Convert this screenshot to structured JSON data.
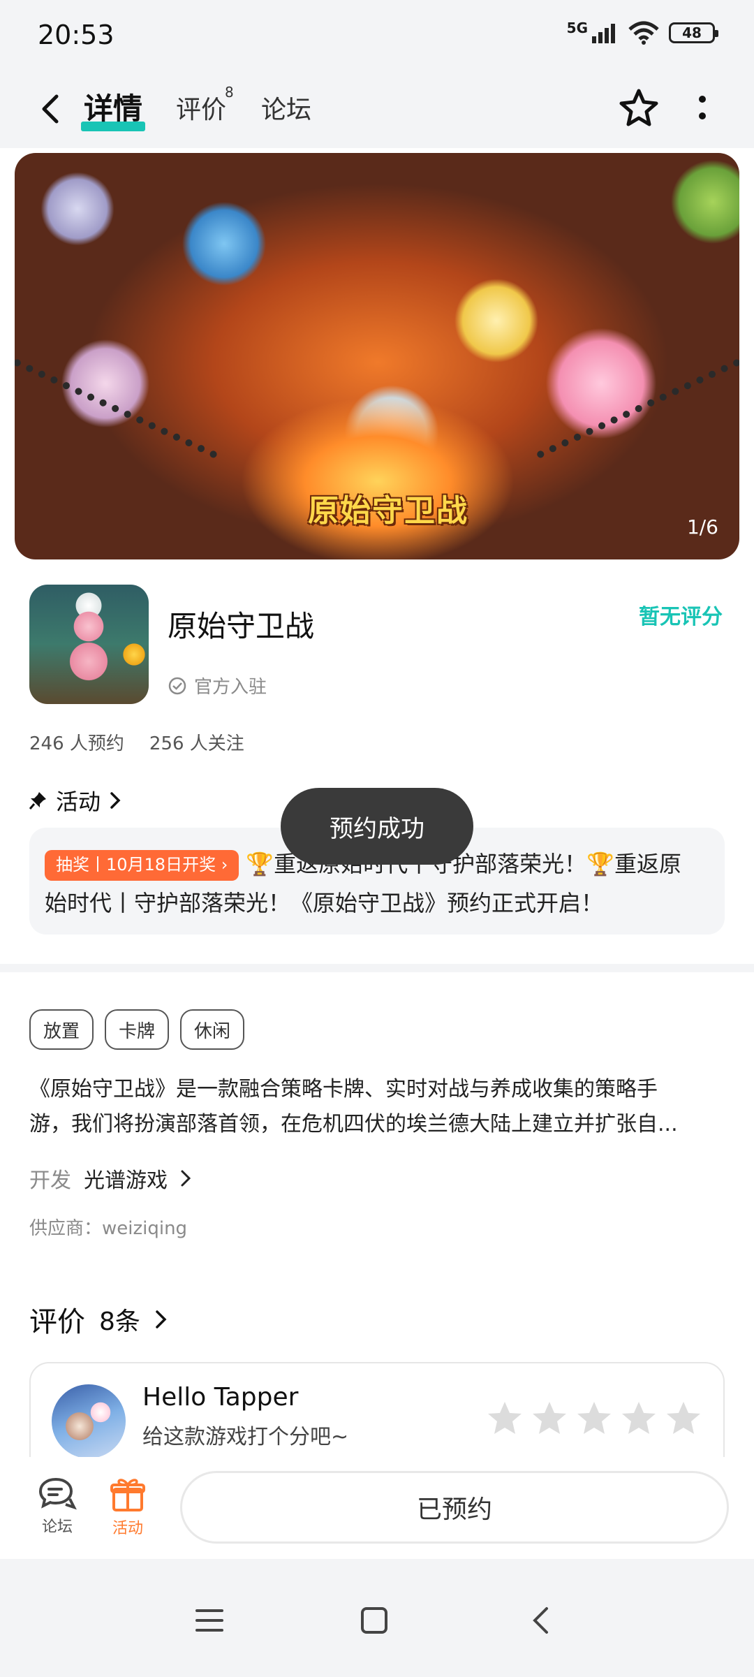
{
  "status_bar": {
    "time": "20:53",
    "network": "5G",
    "battery": "48"
  },
  "nav": {
    "tabs": [
      {
        "label": "详情"
      },
      {
        "label": "评价",
        "badge": "8"
      },
      {
        "label": "论坛"
      }
    ]
  },
  "banner": {
    "logo_text": "原始守卫战",
    "counter": "1/6"
  },
  "game": {
    "title": "原始守卫战",
    "official": "官方入驻",
    "rating": "暂无评分",
    "reservations": "246 人预约",
    "followers": "256 人关注"
  },
  "activity": {
    "label": "活动",
    "tag": "抽奖丨10月18日开奖",
    "line1": "重返原始时代丨守护部落荣光！",
    "line1b": "重返原",
    "line2": "始时代丨守护部落荣光！《原始守卫战》预约正式开启！"
  },
  "toast": "预约成功",
  "tags": [
    "放置",
    "卡牌",
    "休闲"
  ],
  "description": {
    "line1": "《原始守卫战》是一款融合策略卡牌、实时对战与养成收集的策略手",
    "line2": "游，我们将扮演部落首领，在危机四伏的埃兰德大陆上建立并扩张自..."
  },
  "developer": {
    "label": "开发",
    "name": "光谱游戏"
  },
  "supplier": "供应商：weiziqing",
  "reviews": {
    "title": "评价",
    "count": "8条",
    "user_name": "Hello Tapper",
    "hint": "给这款游戏打个分吧~",
    "stars": 0
  },
  "bottom_bar": {
    "forum": "论坛",
    "activity": "活动",
    "reserved": "已预约"
  },
  "colors": {
    "accent": "#19c4b5",
    "orange": "#ff6a36",
    "toast": "#3a3a3a"
  },
  "icons": [
    "back-icon",
    "star-outline-icon",
    "more-icon",
    "verified-icon",
    "pin-icon",
    "chevron-right-icon",
    "trophy-icon",
    "forum-icon",
    "gift-icon",
    "menu-icon",
    "home-icon",
    "back-nav-icon"
  ]
}
